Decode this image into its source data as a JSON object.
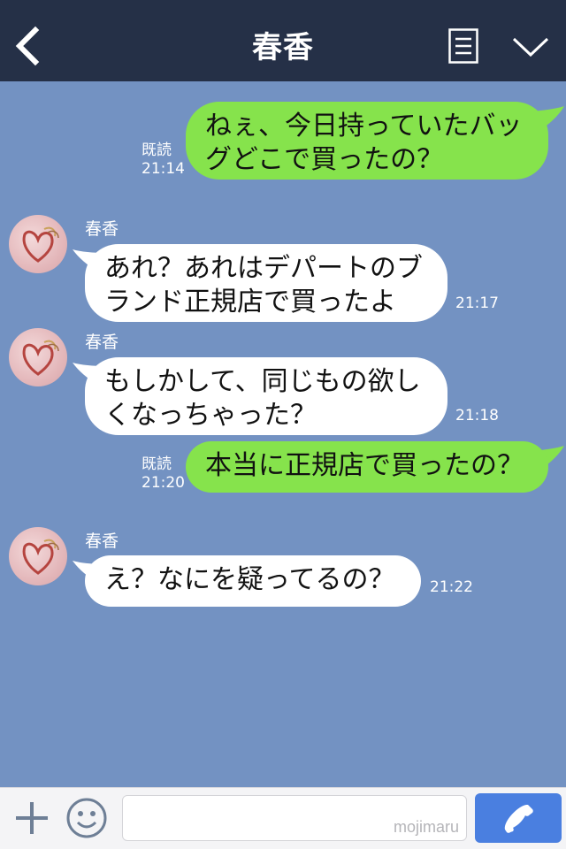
{
  "header": {
    "title": "春香",
    "icons": [
      "back-chevron-icon",
      "menu-list-icon",
      "collapse-chevron-icon"
    ]
  },
  "messages": [
    {
      "type": "sent",
      "text": "ねぇ、今日持っていたバッ\nグどこで買ったの？",
      "read": "既読",
      "time": "21:14"
    },
    {
      "type": "recv",
      "sender": "春香",
      "text": "あれ？あれはデパートのブ\nランド正規店で買ったよ",
      "time": "21:17"
    },
    {
      "type": "recv",
      "sender": "春香",
      "text": "もしかして、同じもの欲し\nくなっちゃった？",
      "time": "21:18"
    },
    {
      "type": "sent",
      "text": "本当に正規店で買ったの？",
      "read": "既読",
      "time": "21:20"
    },
    {
      "type": "recv",
      "sender": "春香",
      "text": "え？なにを疑ってるの？",
      "time": "21:22"
    }
  ],
  "input_bar": {
    "watermark": "mojimaru",
    "icons": [
      "plus-icon",
      "smiley-icon",
      "phone-icon"
    ]
  },
  "colors": {
    "header_bg": "#253047",
    "chat_bg": "#7392c2",
    "sent_bubble": "#86e34c",
    "recv_bubble": "#ffffff",
    "call_button": "#4a7fe0"
  }
}
